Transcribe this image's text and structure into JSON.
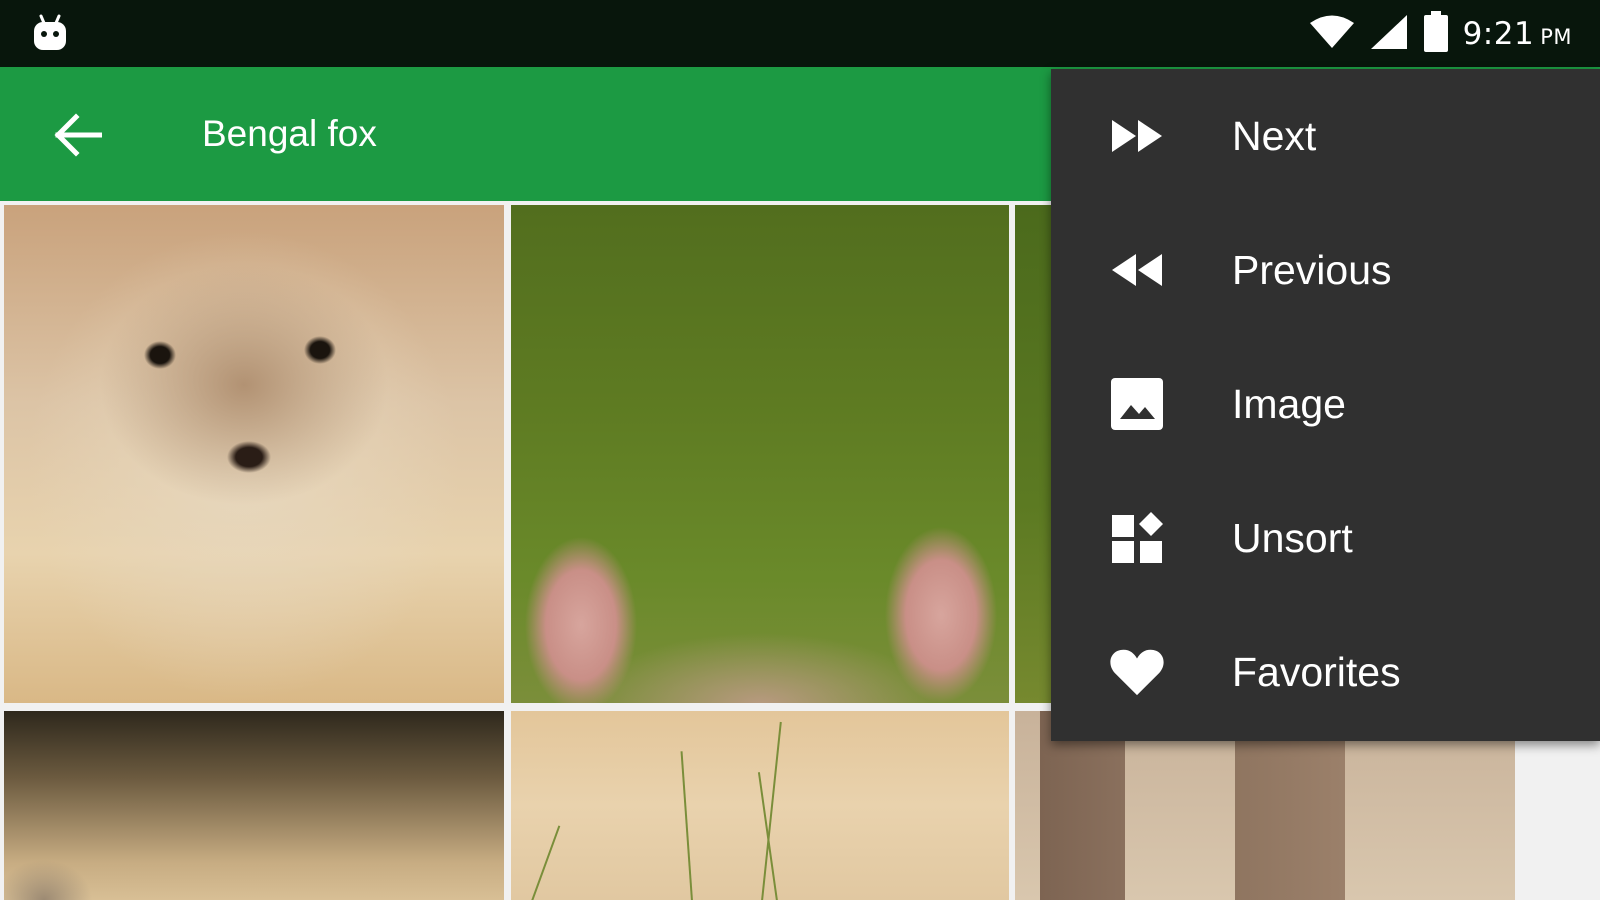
{
  "status_bar": {
    "time": "9:21",
    "ampm": "PM",
    "app_icon": "android-icon",
    "icons": [
      "wifi-icon",
      "cellular-signal-icon",
      "battery-icon"
    ]
  },
  "app_bar": {
    "title": "Bengal fox",
    "back_icon": "back-arrow-icon",
    "background_color": "#1c9a43"
  },
  "gallery": {
    "tiles": [
      {
        "name": "fox-kit-face-photo"
      },
      {
        "name": "fox-ears-photo"
      },
      {
        "name": "green-background-photo"
      },
      {
        "name": "fox-partial-photo"
      },
      {
        "name": "grass-photo"
      },
      {
        "name": "fox-legs-photo"
      }
    ]
  },
  "overflow_menu": {
    "background_color": "#303030",
    "items": [
      {
        "label": "Next",
        "icon": "fast-forward-icon"
      },
      {
        "label": "Previous",
        "icon": "rewind-icon"
      },
      {
        "label": "Image",
        "icon": "image-icon"
      },
      {
        "label": "Unsort",
        "icon": "dashboard-icon"
      },
      {
        "label": "Favorites",
        "icon": "heart-icon"
      }
    ]
  }
}
